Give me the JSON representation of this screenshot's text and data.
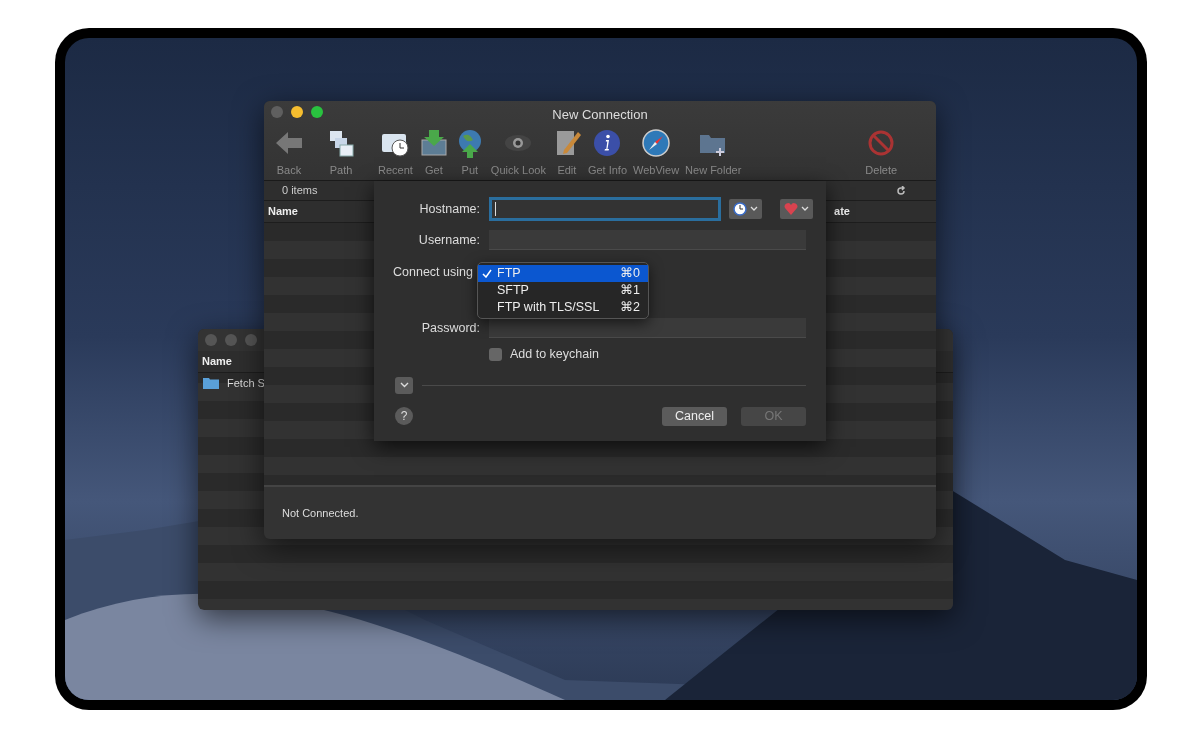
{
  "back_window": {
    "column_header": "Name",
    "rows": [
      {
        "name": "Fetch S"
      }
    ]
  },
  "window": {
    "title": "New Connection",
    "toolbar": [
      {
        "label": "Back"
      },
      {
        "label": "Path"
      },
      {
        "label": "Recent"
      },
      {
        "label": "Get"
      },
      {
        "label": "Put"
      },
      {
        "label": "Quick Look"
      },
      {
        "label": "Edit"
      },
      {
        "label": "Get Info"
      },
      {
        "label": "WebView"
      },
      {
        "label": "New Folder"
      },
      {
        "label": "Delete"
      }
    ],
    "item_count": "0 items",
    "columns": [
      "Name",
      "ate"
    ],
    "status": "Not Connected."
  },
  "sheet": {
    "fields": [
      {
        "label": "Hostname:",
        "focused": true
      },
      {
        "label": "Username:",
        "focused": false
      }
    ],
    "connect_label": "Connect using",
    "menu": [
      {
        "label": "FTP",
        "shortcut": "⌘0",
        "selected": true
      },
      {
        "label": "SFTP",
        "shortcut": "⌘1",
        "selected": false
      },
      {
        "label": "FTP with TLS/SSL",
        "shortcut": "⌘2",
        "selected": false
      }
    ],
    "password_label": "Password:",
    "keychain": {
      "label": "Add to keychain",
      "checked": false
    },
    "help": "?",
    "buttons": [
      {
        "label": "Cancel",
        "disabled": false
      },
      {
        "label": "OK",
        "disabled": true
      }
    ]
  }
}
